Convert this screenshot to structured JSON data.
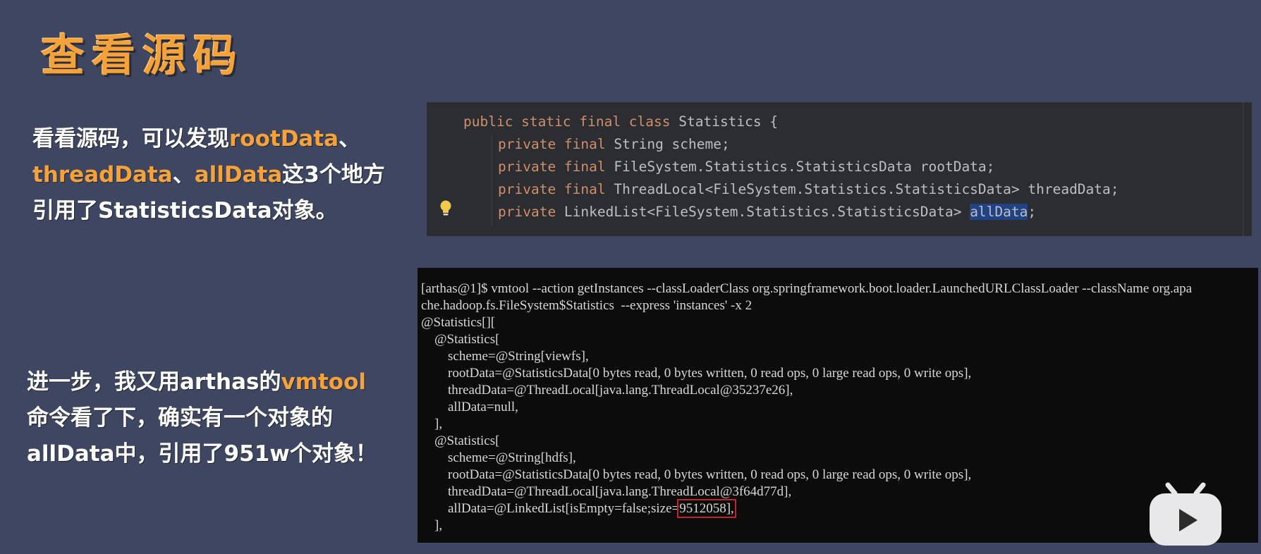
{
  "title": "查看源码",
  "paragraph1": {
    "t1": "看看源码，可以发现",
    "h1": "rootData",
    "t2": "、",
    "h2": "threadData",
    "t3": "、",
    "h3": "allData",
    "t4": "这3个地方",
    "t5": "引用了StatisticsData对象。"
  },
  "paragraph2": {
    "t1": "进一步，我又用arthas的",
    "h1": "vmtool",
    "t2": "命令看了下，确实有一个对象的",
    "t3": "allData中，引用了951w个对象！"
  },
  "code": {
    "l1_kw": "public static final class",
    "l1_rest": " Statistics {",
    "l2_kw": "private final",
    "l2_rest": " String scheme;",
    "l3_kw": "private final",
    "l3_rest": " FileSystem.Statistics.StatisticsData rootData;",
    "l4_kw": "private final",
    "l4_rest": " ThreadLocal<FileSystem.Statistics.StatisticsData> threadData;",
    "l5_kw": "private",
    "l5_rest": " LinkedList<FileSystem.Statistics.StatisticsData> ",
    "l5_sel": "allData",
    "l5_end": ";"
  },
  "terminal": {
    "lines": [
      "[arthas@1]$ vmtool --action getInstances --classLoaderClass org.springframework.boot.loader.LaunchedURLClassLoader --className org.apa",
      "che.hadoop.fs.FileSystem$Statistics  --express 'instances' -x 2",
      "@Statistics[][",
      "    @Statistics[",
      "        scheme=@String[viewfs],",
      "        rootData=@StatisticsData[0 bytes read, 0 bytes written, 0 read ops, 0 large read ops, 0 write ops],",
      "        threadData=@ThreadLocal[java.lang.ThreadLocal@35237e26],",
      "        allData=null,",
      "    ],",
      "    @Statistics[",
      "        scheme=@String[hdfs],",
      "        rootData=@StatisticsData[0 bytes read, 0 bytes written, 0 read ops, 0 large read ops, 0 write ops],",
      "        threadData=@ThreadLocal[java.lang.ThreadLocal@3f64d77d],"
    ],
    "last_prefix": "        allData=@LinkedList[isEmpty=false;size=",
    "last_boxed": "9512058],",
    "closing": "    ],"
  },
  "colors": {
    "background": "#3f4661",
    "accent": "#f6a23a",
    "editor_bg": "#2b2d30",
    "terminal_bg": "#0c0c0c",
    "highlight_box": "#c0262b"
  },
  "icons": {
    "bulb": "lightbulb-icon",
    "logo": "bilibili-logo"
  }
}
